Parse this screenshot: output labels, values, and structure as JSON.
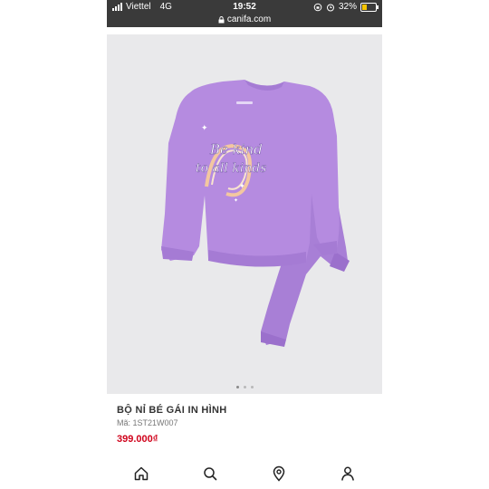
{
  "status_bar": {
    "carrier": "Viettel",
    "network": "4G",
    "time": "19:52",
    "battery": "32%",
    "url": "canifa.com"
  },
  "product": {
    "title": "BỘ NỈ BÉ GÁI IN HÌNH",
    "code": "Mã: 1ST21W007",
    "price": "399.000₫",
    "print_line1": "Be kind",
    "print_line2": "to all kinds",
    "image_colors": {
      "garment": "#b58be0",
      "background": "#e9e9eb"
    },
    "carousel_active_index": 1,
    "carousel_total": 3
  },
  "bottom_nav": {
    "items": [
      "home-icon",
      "search-icon",
      "location-icon",
      "user-icon"
    ]
  }
}
